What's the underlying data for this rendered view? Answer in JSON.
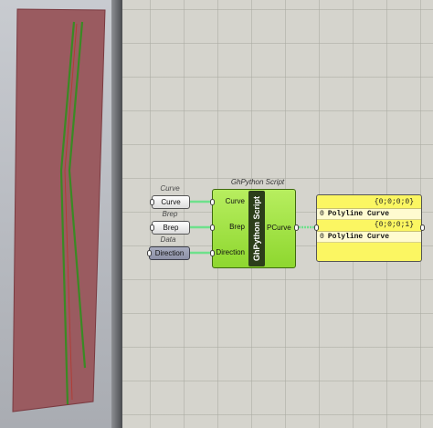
{
  "viewport": {
    "surface_color": "#9a5b60",
    "curve_color": "#3a8a24"
  },
  "canvas": {
    "component": {
      "title": "GhPython Script",
      "name": "GhPython Script",
      "inputs": [
        "Curve",
        "Brep",
        "Direction"
      ],
      "output": "PCurve",
      "color": "#9fe040"
    },
    "params": [
      {
        "label": "Curve",
        "name": "Curve"
      },
      {
        "label": "Brep",
        "name": "Brep"
      },
      {
        "label": "Data",
        "name": "Direction"
      }
    ],
    "panel": {
      "rows": [
        {
          "path": "{0;0;0;0}",
          "index": "0",
          "value": "Polyline Curve"
        },
        {
          "path": "{0;0;0;1}",
          "index": "0",
          "value": "Polyline Curve"
        }
      ]
    },
    "wire_color": "#6ee08c"
  }
}
